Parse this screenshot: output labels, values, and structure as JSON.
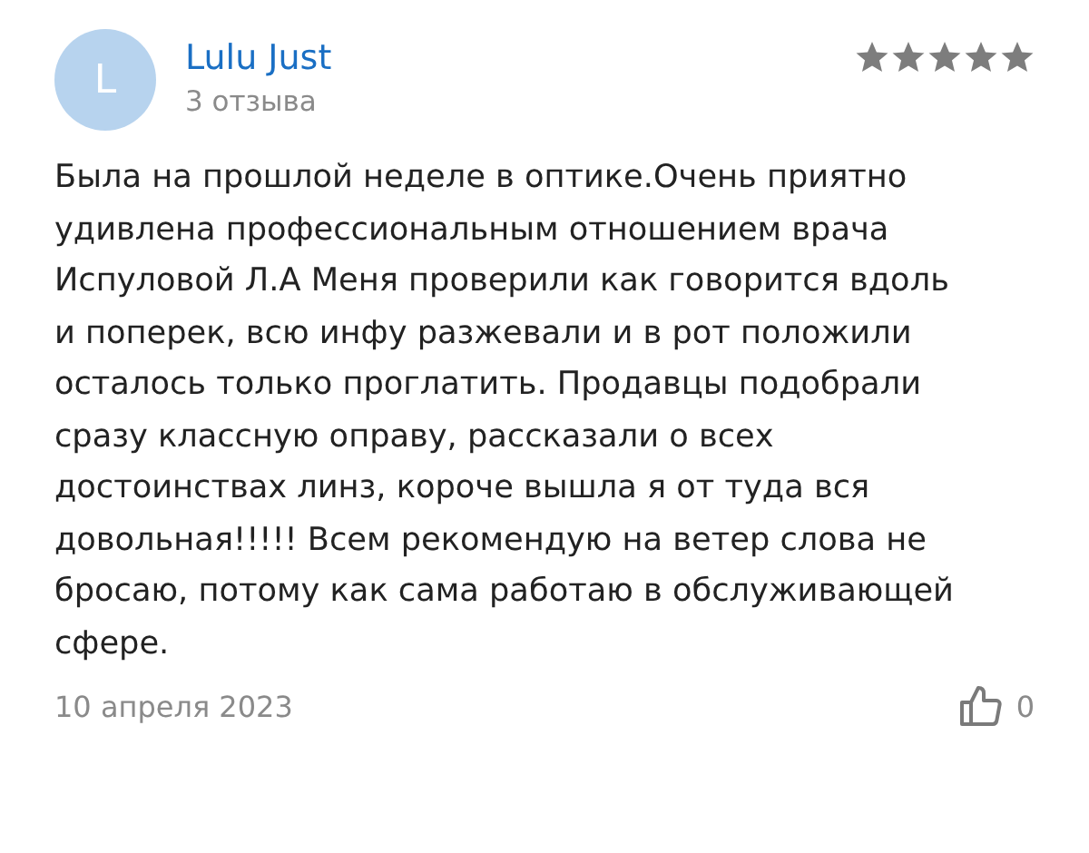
{
  "review": {
    "avatar_letter": "L",
    "author": "Lulu Just",
    "review_count": "3 отзыва",
    "stars": 5,
    "text": "Была на прошлой неделе в оптике.Очень приятно удивлена профессиональным отношением врача Испуловой Л.А Меня проверили как говорится вдоль и поперек, всю инфу разжевали и в рот положили осталось только проглатить. Продавцы подобрали сразу классную оправу, рассказали о всех достоинствах линз, короче вышла я от туда вся довольная!!!!! Всем рекомендую на ветер слова не бросаю, потому как сама работаю в обслуживающей сфере.",
    "date": "10 апреля 2023",
    "likes": "0"
  }
}
